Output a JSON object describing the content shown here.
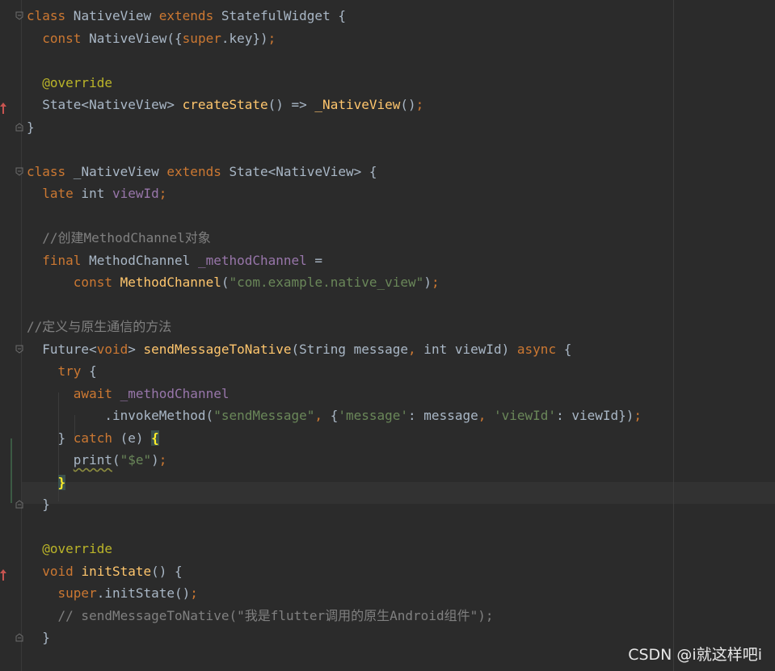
{
  "editor": {
    "lines": [
      [
        {
          "t": "class",
          "c": "kw"
        },
        {
          "t": " NativeView ",
          "c": "plain"
        },
        {
          "t": "extends",
          "c": "kw"
        },
        {
          "t": " StatefulWidget {",
          "c": "plain"
        }
      ],
      [
        {
          "t": "  ",
          "c": "plain"
        },
        {
          "t": "const",
          "c": "kw"
        },
        {
          "t": " NativeView({",
          "c": "plain"
        },
        {
          "t": "super",
          "c": "kw"
        },
        {
          "t": ".key})",
          "c": "plain"
        },
        {
          "t": ";",
          "c": "kw"
        }
      ],
      [],
      [
        {
          "t": "  ",
          "c": "plain"
        },
        {
          "t": "@override",
          "c": "ann"
        }
      ],
      [
        {
          "t": "  State<NativeView> ",
          "c": "plain"
        },
        {
          "t": "createState",
          "c": "fn"
        },
        {
          "t": "() => ",
          "c": "plain"
        },
        {
          "t": "_NativeView",
          "c": "fn"
        },
        {
          "t": "()",
          "c": "plain"
        },
        {
          "t": ";",
          "c": "kw"
        }
      ],
      [
        {
          "t": "}",
          "c": "plain"
        }
      ],
      [],
      [
        {
          "t": "class",
          "c": "kw"
        },
        {
          "t": " _NativeView ",
          "c": "plain"
        },
        {
          "t": "extends",
          "c": "kw"
        },
        {
          "t": " State<NativeView> {",
          "c": "plain"
        }
      ],
      [
        {
          "t": "  ",
          "c": "plain"
        },
        {
          "t": "late",
          "c": "kw"
        },
        {
          "t": " int ",
          "c": "plain"
        },
        {
          "t": "viewId",
          "c": "field"
        },
        {
          "t": ";",
          "c": "kw"
        }
      ],
      [],
      [
        {
          "t": "  //创建MethodChannel对象",
          "c": "cm"
        }
      ],
      [
        {
          "t": "  ",
          "c": "plain"
        },
        {
          "t": "final",
          "c": "kw"
        },
        {
          "t": " MethodChannel ",
          "c": "plain"
        },
        {
          "t": "_methodChannel",
          "c": "field"
        },
        {
          "t": " =",
          "c": "plain"
        }
      ],
      [
        {
          "t": "      ",
          "c": "plain"
        },
        {
          "t": "const",
          "c": "kw"
        },
        {
          "t": " ",
          "c": "plain"
        },
        {
          "t": "MethodChannel",
          "c": "fn"
        },
        {
          "t": "(",
          "c": "plain"
        },
        {
          "t": "\"com.example.native_view\"",
          "c": "str"
        },
        {
          "t": ")",
          "c": "plain"
        },
        {
          "t": ";",
          "c": "kw"
        }
      ],
      [],
      [
        {
          "t": "//定义与原生通信的方法",
          "c": "cm"
        }
      ],
      [
        {
          "t": "  Future<",
          "c": "plain"
        },
        {
          "t": "void",
          "c": "kw"
        },
        {
          "t": "> ",
          "c": "plain"
        },
        {
          "t": "sendMessageToNative",
          "c": "fn"
        },
        {
          "t": "(String message",
          "c": "plain"
        },
        {
          "t": ",",
          "c": "kw"
        },
        {
          "t": " int viewId) ",
          "c": "plain"
        },
        {
          "t": "async",
          "c": "kw"
        },
        {
          "t": " {",
          "c": "plain"
        }
      ],
      [
        {
          "t": "    ",
          "c": "plain"
        },
        {
          "t": "try",
          "c": "kw"
        },
        {
          "t": " {",
          "c": "plain"
        }
      ],
      [
        {
          "t": "      ",
          "c": "plain"
        },
        {
          "t": "await",
          "c": "kw"
        },
        {
          "t": " ",
          "c": "plain"
        },
        {
          "t": "_methodChannel",
          "c": "field"
        }
      ],
      [
        {
          "t": "          .invokeMethod(",
          "c": "plain"
        },
        {
          "t": "\"sendMessage\"",
          "c": "str"
        },
        {
          "t": ", ",
          "c": "kw"
        },
        {
          "t": "{",
          "c": "plain"
        },
        {
          "t": "'message'",
          "c": "str"
        },
        {
          "t": ": message",
          "c": "plain"
        },
        {
          "t": ", ",
          "c": "kw"
        },
        {
          "t": "'viewId'",
          "c": "str"
        },
        {
          "t": ": viewId})",
          "c": "plain"
        },
        {
          "t": ";",
          "c": "kw"
        }
      ],
      [
        {
          "t": "    } ",
          "c": "plain"
        },
        {
          "t": "catch",
          "c": "kw"
        },
        {
          "t": " (e) ",
          "c": "plain"
        },
        {
          "t": "{",
          "c": "brace-hl"
        }
      ],
      [
        {
          "t": "      ",
          "c": "plain"
        },
        {
          "t": "print",
          "c": "warn"
        },
        {
          "t": "(",
          "c": "plain"
        },
        {
          "t": "\"$e\"",
          "c": "str"
        },
        {
          "t": ")",
          "c": "plain"
        },
        {
          "t": ";",
          "c": "kw"
        }
      ],
      [
        {
          "t": "    ",
          "c": "plain"
        },
        {
          "t": "}",
          "c": "brace-hl"
        }
      ],
      [
        {
          "t": "  }",
          "c": "plain"
        }
      ],
      [],
      [
        {
          "t": "  ",
          "c": "plain"
        },
        {
          "t": "@override",
          "c": "ann"
        }
      ],
      [
        {
          "t": "  ",
          "c": "plain"
        },
        {
          "t": "void",
          "c": "kw"
        },
        {
          "t": " ",
          "c": "plain"
        },
        {
          "t": "initState",
          "c": "fn"
        },
        {
          "t": "() {",
          "c": "plain"
        }
      ],
      [
        {
          "t": "    ",
          "c": "plain"
        },
        {
          "t": "super",
          "c": "kw"
        },
        {
          "t": ".initState()",
          "c": "plain"
        },
        {
          "t": ";",
          "c": "kw"
        }
      ],
      [
        {
          "t": "    // sendMessageToNative(\"我是flutter调用的原生Android组件\");",
          "c": "cm"
        }
      ],
      [
        {
          "t": "  }",
          "c": "plain"
        }
      ]
    ]
  },
  "watermark": "CSDN @i就这样吧i"
}
